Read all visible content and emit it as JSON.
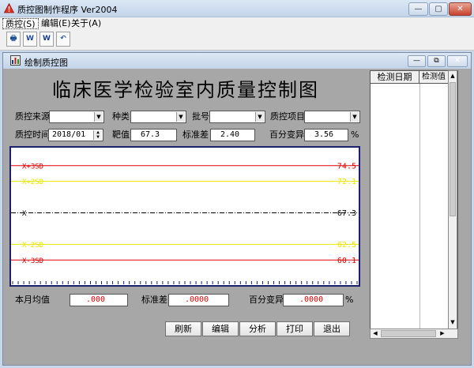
{
  "window": {
    "title": "质控图制作程序 Ver2004",
    "minimize": "—",
    "maximize": "▢",
    "close": "✕"
  },
  "menu": [
    "质控(S)",
    "编辑(E)",
    "关于(A)"
  ],
  "toolbar": [
    "🖶",
    "W",
    "W",
    "↶"
  ],
  "inner": {
    "title": "绘制质控图"
  },
  "form": {
    "main_title": "临床医学检验室内质量控制图",
    "source_label": "质控来源",
    "type_label": "种类",
    "lot_label": "批号",
    "item_label": "质控项目",
    "time_label": "质控时间",
    "time_value": "2018/01",
    "target_label": "靶值",
    "target_value": "67.3",
    "sd_label": "标准差",
    "sd_value": "2.40",
    "cv_label": "百分变异",
    "cv_value": "3.56",
    "cv_unit": "%"
  },
  "chart_data": {
    "type": "line",
    "y_range": [
      57.0,
      77.0
    ],
    "lines": [
      {
        "label": "X+3SD",
        "value": 74.5,
        "color": "#e00000",
        "style": "solid"
      },
      {
        "label": "X+2SD",
        "value": 72.1,
        "color": "#e8e800",
        "style": "solid"
      },
      {
        "label": "X",
        "value": 67.3,
        "color": "#000000",
        "style": "dashdot"
      },
      {
        "label": "X-2SD",
        "value": 62.5,
        "color": "#e8e800",
        "style": "solid"
      },
      {
        "label": "X-3SD",
        "value": 60.1,
        "color": "#e00000",
        "style": "solid"
      }
    ],
    "value_labels": [
      "74.5",
      "72.1",
      "67.3",
      "62.5",
      "60.1"
    ],
    "tick_count": 62
  },
  "stats": {
    "mean_label": "本月均值",
    "mean_value": ".000",
    "sd_label": "标准差",
    "sd_value": ".0000",
    "cv_label": "百分变异",
    "cv_value": ".0000",
    "cv_unit": "%"
  },
  "buttons": {
    "refresh": "刷新",
    "edit": "编辑",
    "analyze": "分析",
    "print": "打印",
    "exit": "退出"
  },
  "grid": {
    "col1": "检测日期",
    "col2": "检测值"
  },
  "colors": {
    "title_bar": "#c8d7ea",
    "client_bg": "#a7a7a7",
    "chart_frame": "#1c1f6b"
  }
}
